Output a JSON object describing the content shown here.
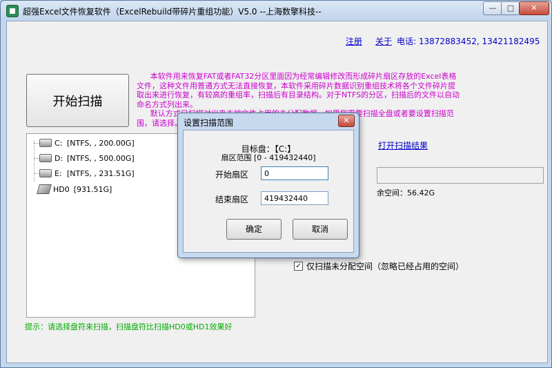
{
  "window": {
    "title": "超强Excel文件恢复软件（ExcelRebuild带碎片重组功能）V5.0  --上海数擎科技--",
    "minimize": "—",
    "maximize": "□",
    "close": "✕"
  },
  "header": {
    "register_link": "注册",
    "about_link": "关于",
    "phone": "电话: 13872883452, 13421182495"
  },
  "scan_button": "开始扫描",
  "description": [
    "本软件用来恢复FAT或者FAT32分区里面因为经常编辑修改而形成碎片扇区存放的Excel表格文件，这种文件用普通方式无法直接恢复，本软件采用碎片数据识别重组技术将各个文件碎片提取出来进行恢复，有较高的重组率，扫描后有目录结构。对于NTFS的分区，扫描后的文件以自动命名方式列出来。",
    "默认方式只扫描对出来未被文件占用的未分配数据，如果您需要扫描全盘或者要设置扫描范围，请选择。"
  ],
  "tree": {
    "items": [
      {
        "drive": "C:",
        "info": "[NTFS, , 200.00G]"
      },
      {
        "drive": "D:",
        "info": "[NTFS, , 500.00G]"
      },
      {
        "drive": "E:",
        "info": "[NTFS, , 231.51G]"
      },
      {
        "drive": "HD0",
        "info": "[931.51G]"
      }
    ]
  },
  "tip": "提示：请选择盘符来扫描，扫描盘符比扫描HD0或HD1效果好",
  "open_result_link": "打开扫描结果",
  "free_space": "余空间：56.42G",
  "checkbox": {
    "label": "仅扫描未分配空间（忽略已经占用的空间）",
    "mark": "✓"
  },
  "dialog": {
    "title": "设置扫描范围",
    "close": "✕",
    "target": "目标盘：【C:】",
    "range": "扇区范围 [0 - 419432440]",
    "start_label": "开始扇区",
    "start_value": "0",
    "end_label": "结束扇区",
    "end_value": "419432440",
    "ok": "确定",
    "cancel": "取消"
  }
}
